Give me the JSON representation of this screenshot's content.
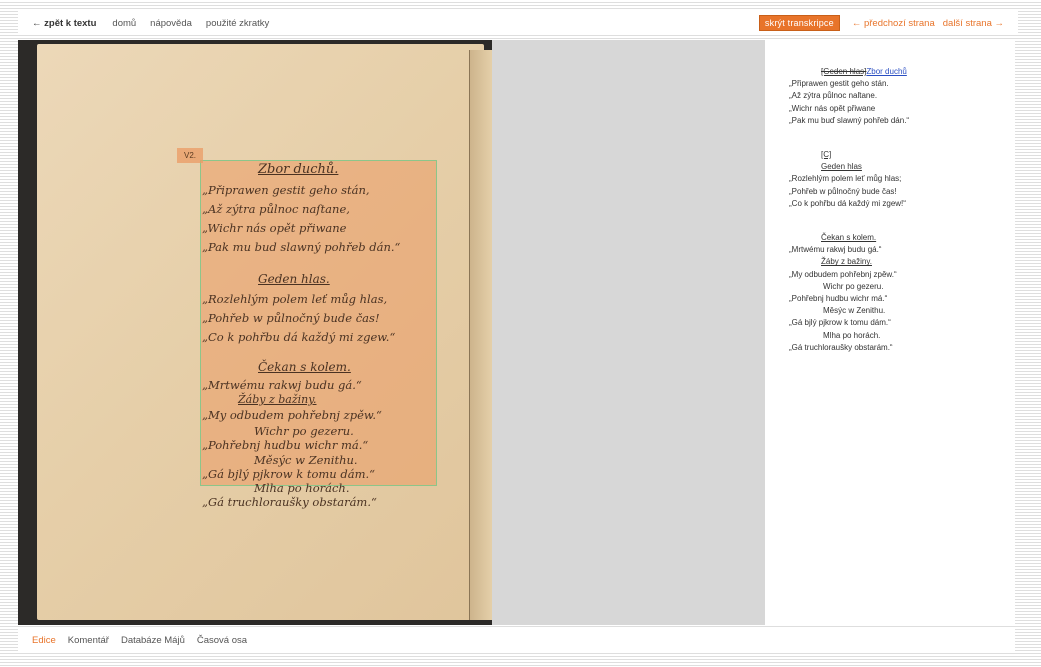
{
  "topnav": {
    "back": "← zpět k textu",
    "home": "domů",
    "help": "nápověda",
    "abbr": "použité zkratky",
    "hide_transcript": "skrýt transkripce",
    "prev_page": "← předchozí strana",
    "next_page": "další strana →"
  },
  "manuscript": {
    "verse_label": "V2.",
    "lines": [
      "Zbor duchů.",
      "„Připrawen gestit geho stán,",
      "„Až zýtra půlnoc naſtane,",
      "„Wichr nás opět přiwane",
      "„Pak mu bud slawný pohřeb dán.“",
      "Geden hlas.",
      "„Rozlehlým polem leť můg hlas,",
      "„Pohřeb w půlnočný bude čas!",
      "„Co k pohřbu dá každý mi zgew.“",
      "Čekan s kolem.",
      "„Mrtwému rakwj budu gá.“",
      "Žáby z bažiny.",
      "„My odbudem pohřebnj zpěw.“",
      "Wichr po gezeru.",
      "„Pohřebnj hudbu wichr má.“",
      "Měsýc w Zenithu.",
      "„Gá bjlý pjkrow k tomu dám.“",
      "Mlha po horách.",
      "„Gá truchloraušky obstarám.“"
    ]
  },
  "transcript": {
    "b1_strike": "[Geden hlas]",
    "b1_head": "Zbor duchů",
    "b1_l1": "„Připrawen gestit geho stán.",
    "b1_l2": "„Až zýtra půlnoc naſtane.",
    "b1_l3": "„Wichr nás opět přiwane",
    "b1_l4": "„Pak mu buď slawný pohřeb dán.“",
    "b2_mark": "[C]",
    "b2_head": "Geden hlas",
    "b2_l1": "„Rozlehlým polem leť můg hlas;",
    "b2_l2": "„Pohřeb w půlnočný bude čas!",
    "b2_l3": "„Co k pohřbu dá každý mi zgew!“",
    "b3_head": "Čekan s kolem.",
    "b3_l1": "„Mrtwému rakwj budu gá.“",
    "b3_h2": "Žáby z bažiny.",
    "b3_l2": "„My odbudem pohřebnj zpěw.“",
    "b3_h3": "Wichr po gezeru.",
    "b3_l3": "„Pohřebnj hudbu wichr má.“",
    "b3_h4": "Měsýc w Zenithu.",
    "b3_l4": "„Gá bjlý pjkrow k tomu dám.“",
    "b3_h5": "Mlha po horách.",
    "b3_l5": "„Gá truchloraušky obstarám.“"
  },
  "bottomnav": {
    "edition": "Edice",
    "commentary": "Komentář",
    "database": "Databáze Májů",
    "timeline": "Časová osa"
  },
  "colors": {
    "accent": "#e8742a",
    "highlight": "#eb9b64",
    "highlight_border": "#8cc58a"
  }
}
